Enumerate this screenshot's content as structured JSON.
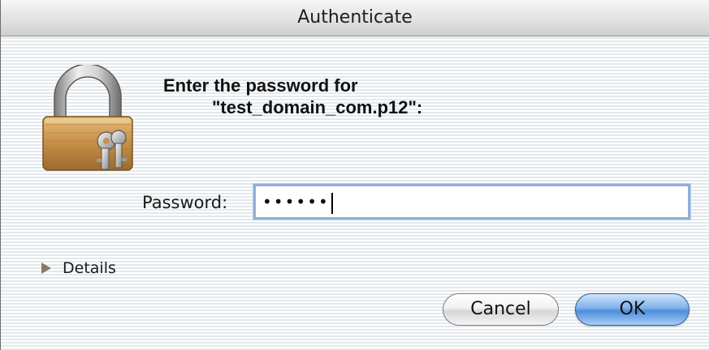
{
  "window": {
    "title": "Authenticate"
  },
  "message": {
    "line1": "Enter the password for",
    "line2": "\"test_domain_com.p12\":"
  },
  "password": {
    "label": "Password:",
    "value": "••••••"
  },
  "details": {
    "label": "Details"
  },
  "buttons": {
    "cancel": "Cancel",
    "ok": "OK"
  },
  "icons": {
    "lock": "padlock-with-keys-icon",
    "disclosure": "disclosure-triangle-icon"
  },
  "colors": {
    "accent": "#5f97df",
    "field_focus": "#8fb0d6",
    "lock_body": "#c9924a"
  }
}
